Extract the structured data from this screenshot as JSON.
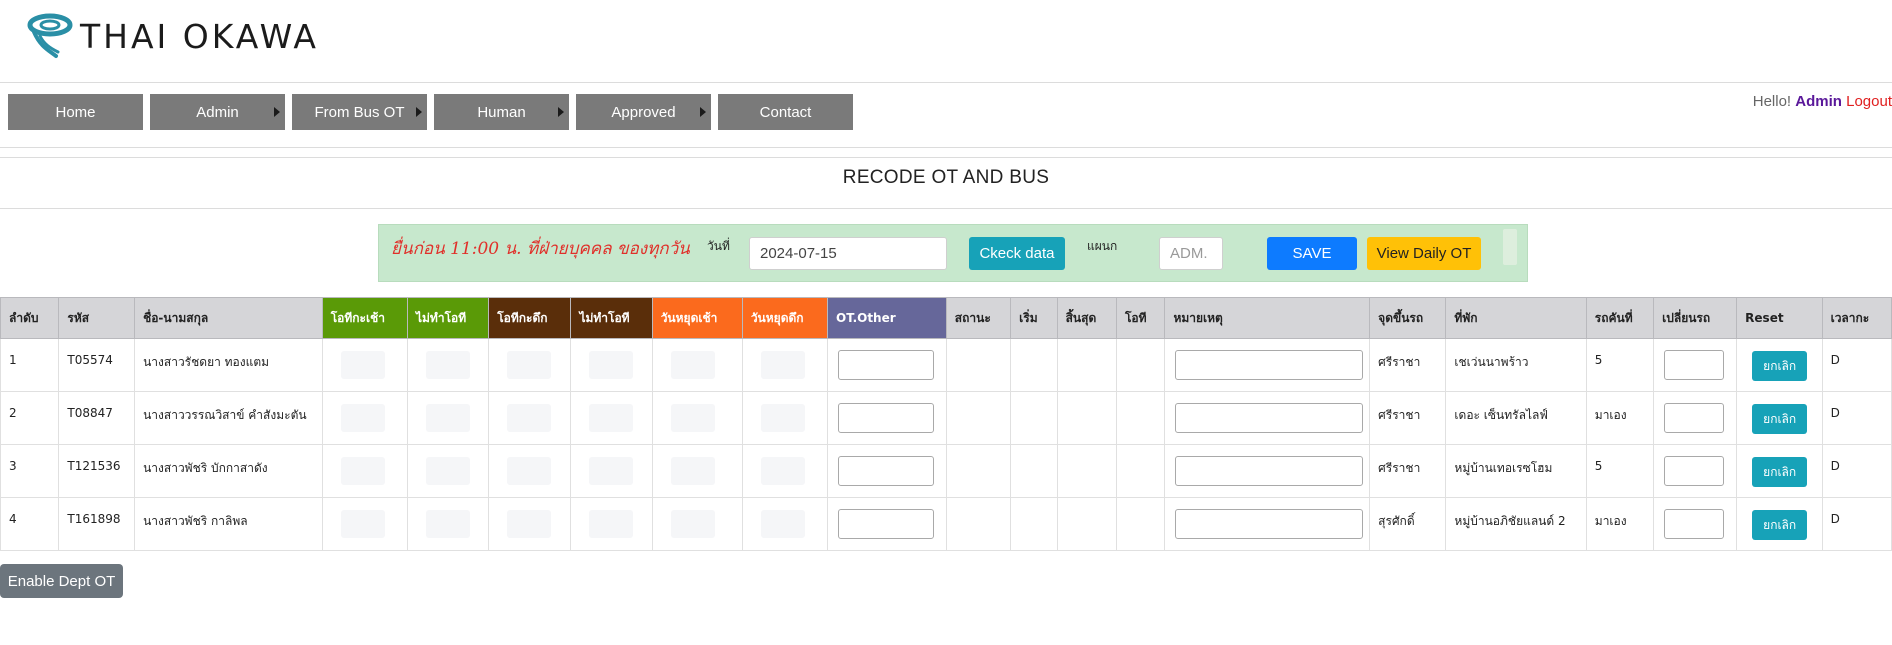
{
  "brand": {
    "name": "THAI OKAWA",
    "logo_color": "#2a8fa6"
  },
  "nav": [
    {
      "label": "Home",
      "has_submenu": false
    },
    {
      "label": "Admin",
      "has_submenu": true
    },
    {
      "label": "From Bus OT",
      "has_submenu": true
    },
    {
      "label": "Human",
      "has_submenu": true
    },
    {
      "label": "Approved",
      "has_submenu": true
    },
    {
      "label": "Contact",
      "has_submenu": false
    }
  ],
  "user": {
    "hello": "Hello!",
    "name": "Admin",
    "logout": "Logout"
  },
  "page_title": "RECODE OT AND BUS",
  "toolbar": {
    "notice": "ยื่นก่อน 11:00 น. ที่ฝ่ายบุคคล ของทุกวัน",
    "date_label": "วันที่",
    "date_value": "2024-07-15",
    "check_button": "Ckeck data",
    "dept_label": "แผนก",
    "dept_placeholder": "ADM.",
    "save_button": "SAVE",
    "view_button": "View Daily OT"
  },
  "table": {
    "columns": [
      "ลำดับ",
      "รหัส",
      "ชื่อ-นามสกุล",
      "โอทีกะเช้า",
      "ไม่ทำโอที",
      "โอทีกะดึก",
      "ไม่ทำโอที",
      "วันหยุดเช้า",
      "วันหยุดดึก",
      "OT.Other",
      "สถานะ",
      "เริ่ม",
      "สิ้นสุด",
      "โอที",
      "หมายเหตุ",
      "จุดขึ้นรถ",
      "ที่พัก",
      "รถคันที่",
      "เปลี่ยนรถ",
      "Reset",
      "เวลากะ"
    ],
    "column_colors": {
      "green": "#5a9a07",
      "brown": "#5a2e0a",
      "orange": "#fb6a1d",
      "purple": "#66679a"
    },
    "rows": [
      {
        "no": "1",
        "code": "T05574",
        "name": "นางสาวรัชดยา ทองแตม",
        "pickup": "ศรีราชา",
        "residence": "เชเว่นนาพร้าว",
        "car": "5",
        "reset": "ยกเลิก",
        "shift": "D"
      },
      {
        "no": "2",
        "code": "T08847",
        "name": "นางสาววรรณวิสาข์ คำสังมะตัน",
        "pickup": "ศรีราชา",
        "residence": "เดอะ เซ็นทรัลไลฟ์",
        "car": "มาเอง",
        "reset": "ยกเลิก",
        "shift": "D"
      },
      {
        "no": "3",
        "code": "T121536",
        "name": "นางสาวพัชริ บักกาสาดัง",
        "pickup": "ศรีราชา",
        "residence": "หมู่บ้านเทอเรซโฮม",
        "car": "5",
        "reset": "ยกเลิก",
        "shift": "D"
      },
      {
        "no": "4",
        "code": "T161898",
        "name": "นางสาวพัชริ กาลิพล",
        "pickup": "สุรศักดิ์",
        "residence": "หมู่บ้านอภิชัยแลนด์ 2",
        "car": "มาเอง",
        "reset": "ยกเลิก",
        "shift": "D"
      }
    ]
  },
  "enable_button": "Enable Dept OT"
}
